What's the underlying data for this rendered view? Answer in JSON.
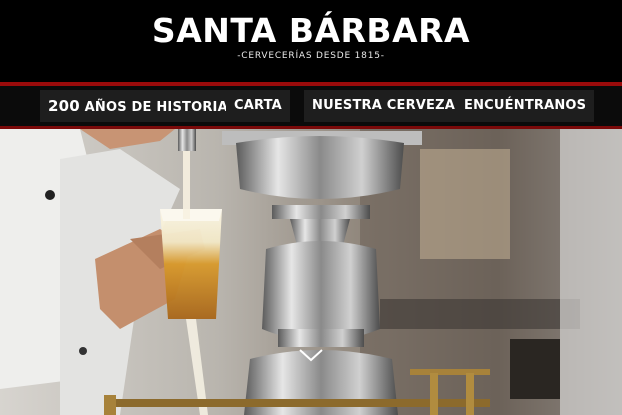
{
  "brand": {
    "name": "SANTA BÁRBARA",
    "tagline": "-CERVECERÍAS DESDE 1815-"
  },
  "nav": {
    "items": [
      {
        "number": "200",
        "label": " AÑOS DE HISTORIA"
      },
      {
        "label": "CARTA"
      },
      {
        "label": "NUESTRA CERVEZA"
      },
      {
        "label": "ENCUÉNTRANOS"
      }
    ]
  },
  "hero": {
    "scroll_icon": "chevron-down-icon"
  },
  "colors": {
    "header_bg": "#000000",
    "accent_red": "#9a0b0b",
    "nav_item_bg": "#1e1e1e",
    "text": "#ffffff"
  }
}
